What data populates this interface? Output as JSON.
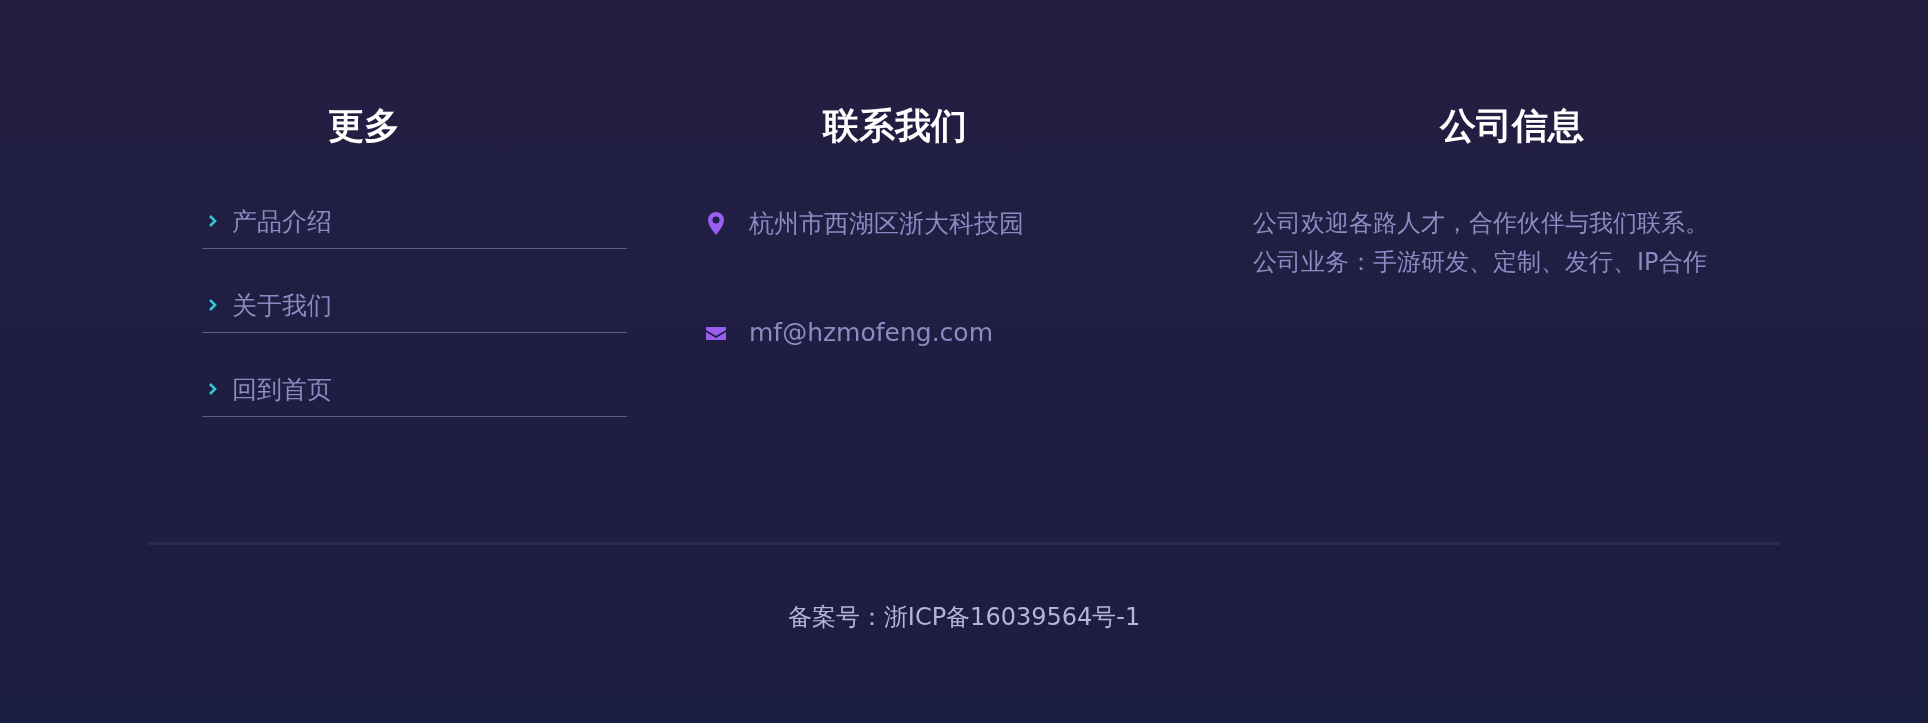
{
  "columns": [
    {
      "title": "更多",
      "links": [
        "产品介绍",
        "关于我们",
        "回到首页"
      ]
    },
    {
      "title": "联系我们",
      "contacts": [
        {
          "kind": "location",
          "text": "杭州市西湖区浙大科技园"
        },
        {
          "kind": "email",
          "text": "mf@hzmofeng.com"
        }
      ]
    },
    {
      "title": "公司信息",
      "lines": [
        "公司欢迎各路人才，合作伙伴与我们联系。",
        "公司业务：手游研发、定制、发行、IP合作"
      ]
    }
  ],
  "footer": {
    "icp": "备案号：浙ICP备16039564号-1"
  }
}
